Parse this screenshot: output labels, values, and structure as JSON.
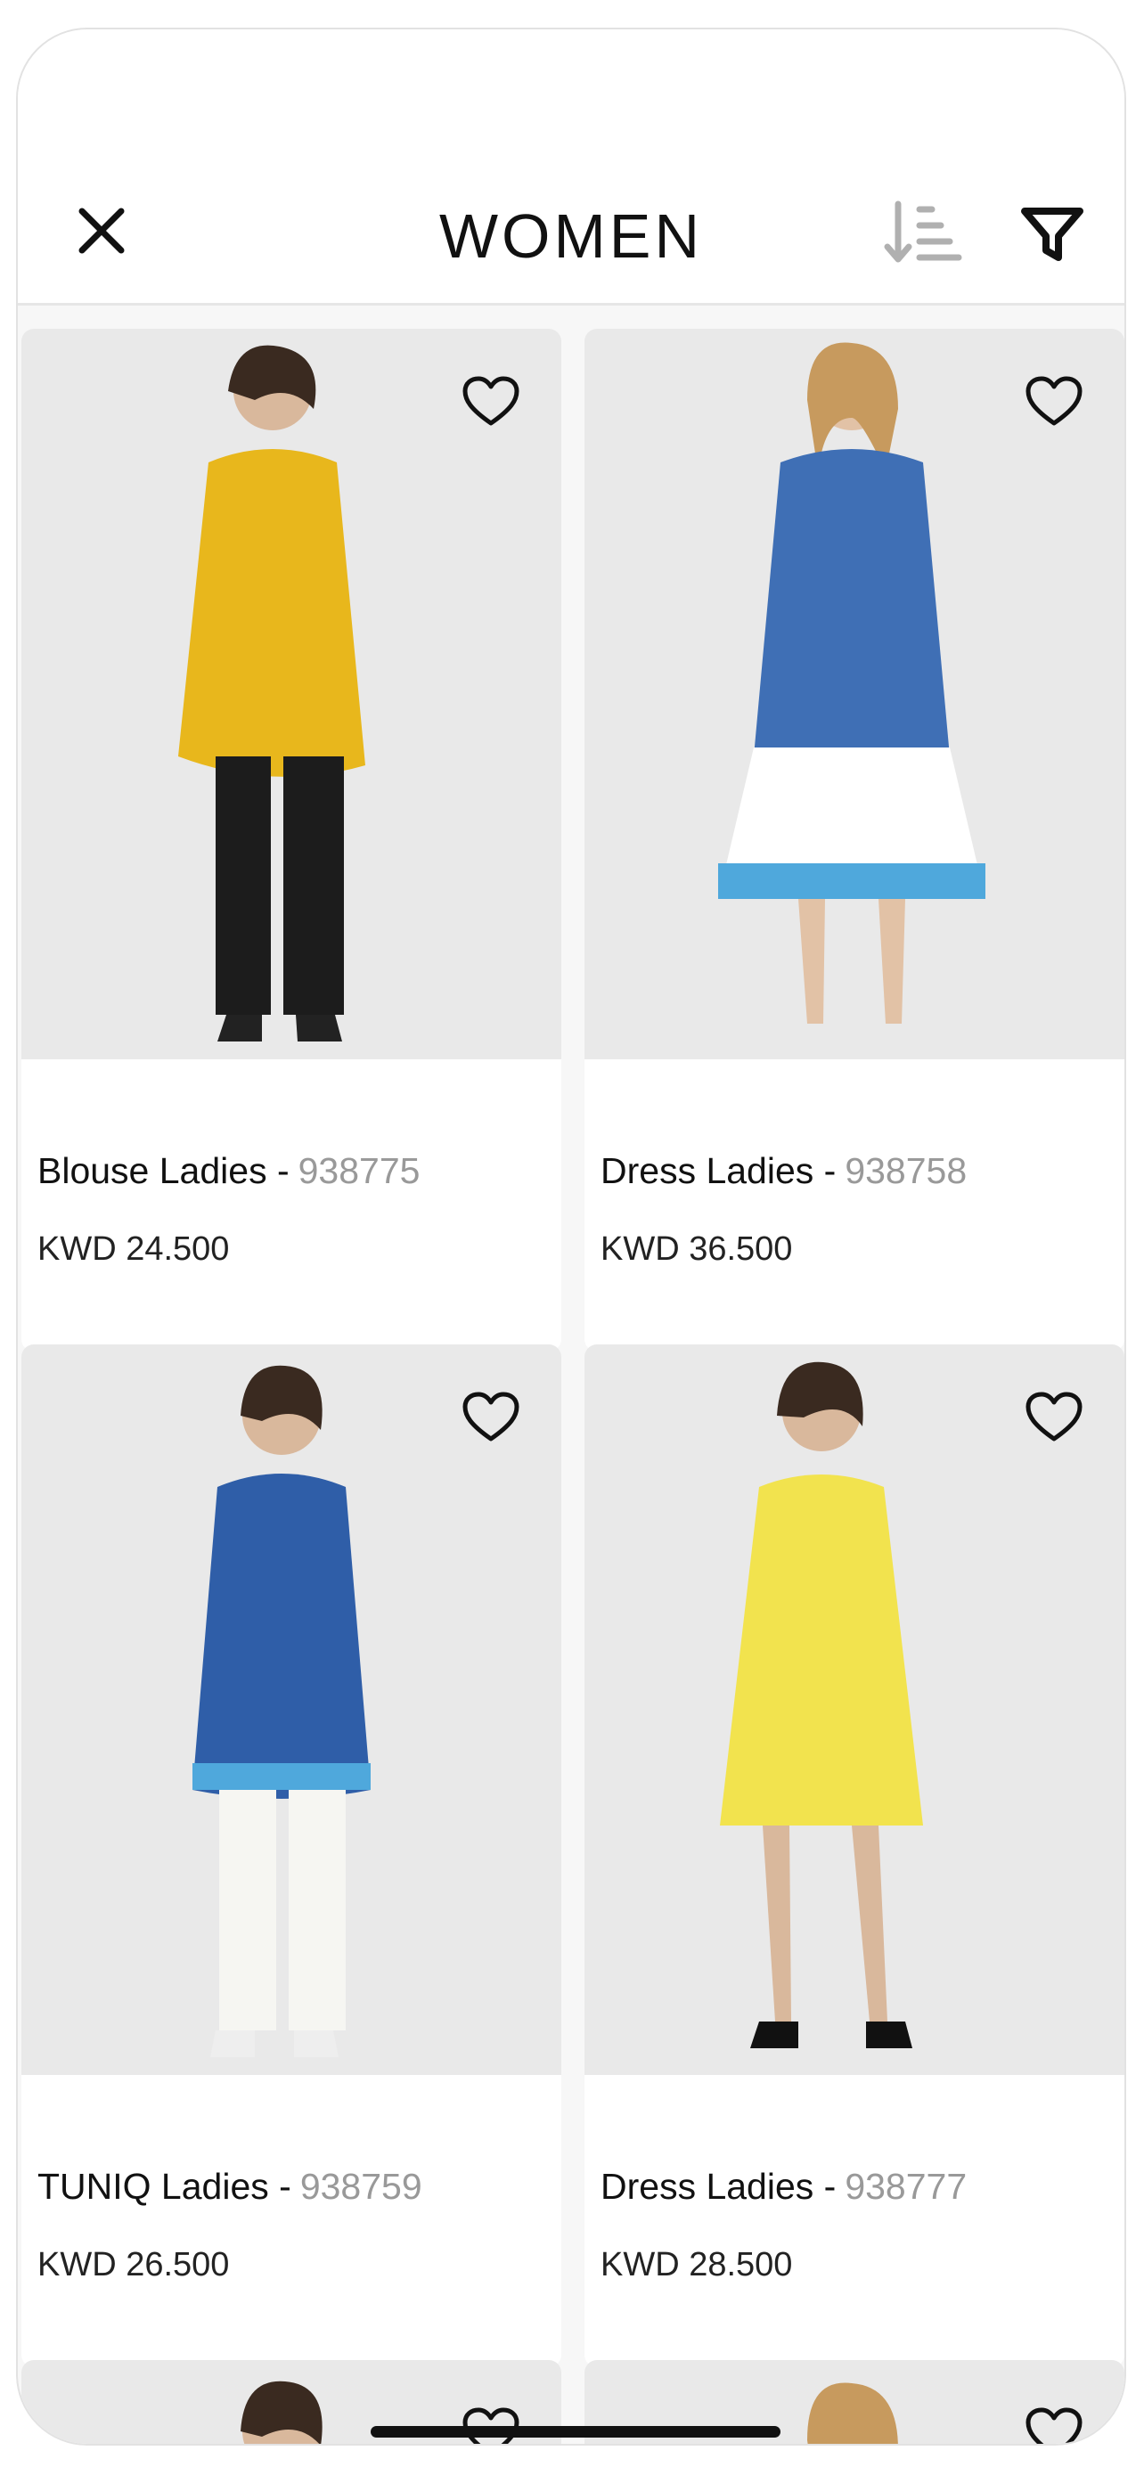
{
  "header": {
    "title": "WOMEN",
    "close_icon": "close-icon",
    "sort_icon": "sort-icon",
    "filter_icon": "filter-icon"
  },
  "products": [
    {
      "name": "Blouse Ladies -",
      "code": "938775",
      "price": "KWD 24.500",
      "top_color": "#e8b71c",
      "bottom_color": "#1c1c1c"
    },
    {
      "name": "Dress Ladies -",
      "code": "938758",
      "price": "KWD 36.500",
      "top_color": "#3f6fb5",
      "bottom_color": "#ffffff"
    },
    {
      "name": "TUNIQ Ladies -",
      "code": "938759",
      "price": "KWD 26.500",
      "top_color": "#2f5ea8",
      "bottom_color": "#f6f6f2"
    },
    {
      "name": "Dress Ladies -",
      "code": "938777",
      "price": "KWD 28.500",
      "top_color": "#f2e34e",
      "bottom_color": "#f2e34e"
    }
  ],
  "colors": {
    "accent": "#111111",
    "code_gray": "#999999",
    "photo_bg": "#e9e9e9"
  }
}
